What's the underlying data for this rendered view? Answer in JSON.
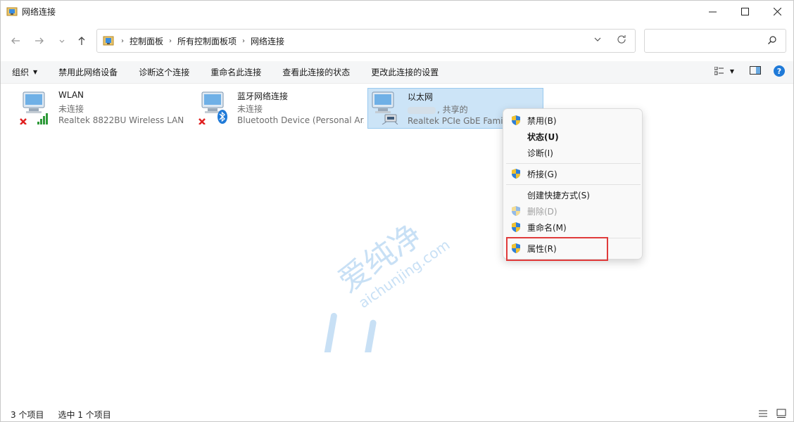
{
  "window": {
    "title": "网络连接"
  },
  "breadcrumb": [
    "控制面板",
    "所有控制面板项",
    "网络连接"
  ],
  "search": {
    "placeholder": ""
  },
  "commands": {
    "organize": "组织",
    "disable_device": "禁用此网络设备",
    "diagnose": "诊断这个连接",
    "rename": "重命名此连接",
    "view_status": "查看此连接的状态",
    "change_settings": "更改此连接的设置"
  },
  "connections": [
    {
      "name": "WLAN",
      "status": "未连接",
      "device": "Realtek 8822BU Wireless LAN ..."
    },
    {
      "name": "蓝牙网络连接",
      "status": "未连接",
      "device": "Bluetooth Device (Personal Ar..."
    },
    {
      "name": "以太网",
      "status": ", 共享的",
      "device": "Realtek PCIe GbE Famil"
    }
  ],
  "context_menu": {
    "disable": "禁用(B)",
    "status": "状态(U)",
    "diagnose": "诊断(I)",
    "bridge": "桥接(G)",
    "create_shortcut": "创建快捷方式(S)",
    "delete": "删除(D)",
    "rename": "重命名(M)",
    "properties": "属性(R)"
  },
  "watermark": {
    "cn": "爱纯净",
    "url": "aichunjing.com"
  },
  "statusbar": {
    "count": "3 个项目",
    "selected": "选中 1 个项目"
  },
  "colors": {
    "accent": "#1f7ad8",
    "selection": "#cce4f7",
    "highlight_box": "#e03b3b"
  }
}
